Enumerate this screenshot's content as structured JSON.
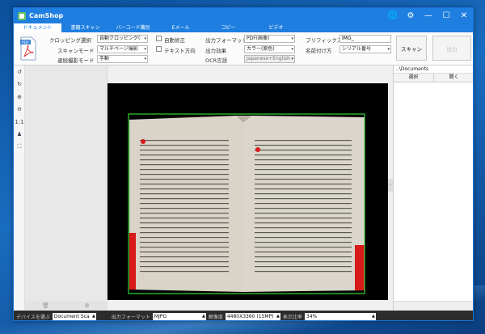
{
  "app": {
    "title": "CamShop"
  },
  "tabs": [
    {
      "label": "ドキュメント",
      "active": true
    },
    {
      "label": "書籍スキャン"
    },
    {
      "label": "バーコード識別"
    },
    {
      "label": "Eメール"
    },
    {
      "label": "コピー"
    },
    {
      "label": "ビデオ"
    }
  ],
  "ribbon": {
    "pdf_icon_label": "PDF",
    "cropping_label": "クロッピング選択",
    "cropping_value": "自動クロッピング(",
    "scan_mode_label": "スキャンモード",
    "scan_mode_value": "マルチページ撮影",
    "continuous_label": "連続撮影モード",
    "continuous_value": "手動",
    "auto_correct_label": "自動修正",
    "text_direction_label": "テキスト方向",
    "output_format_label": "出力フォーマット",
    "output_format_value": "PDF(画像)",
    "output_effect_label": "出力効果",
    "output_effect_value": "カラー(原色)",
    "ocr_label": "OCR言語",
    "ocr_value": "Japanese+English",
    "prefix_label": "プリフィックス",
    "prefix_value": "IMG_",
    "naming_label": "名前付け方",
    "naming_value": "シリアル番号",
    "scan_button": "スキャン",
    "output_button": "出力"
  },
  "right_pane": {
    "path": "..\\Documents",
    "select_button": "選択",
    "open_button": "開く"
  },
  "status": {
    "device_label": "デバイスを選ぶ",
    "device_value": "Document Sca",
    "output_format_label": "出力フォーマット",
    "output_format_value": "MJPG",
    "resolution_label": "解像度",
    "resolution_value": "4480X3360 (15MP)",
    "display_ratio_label": "表示比率",
    "display_ratio_value": "34%"
  },
  "colors": {
    "accent": "#1f7fe0",
    "crop_frame": "#3cff3c"
  }
}
